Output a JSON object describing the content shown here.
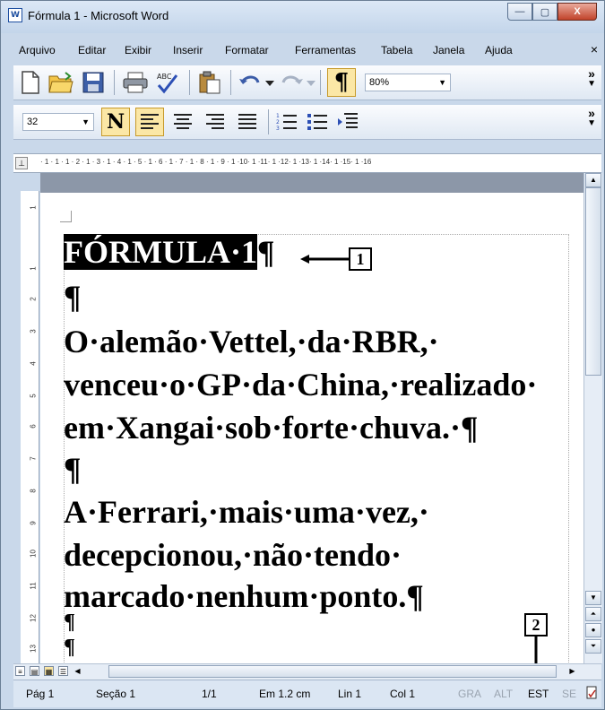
{
  "window": {
    "title": "Fórmula 1 - Microsoft Word",
    "app_icon": "W"
  },
  "title_buttons": {
    "minimize": "—",
    "maximize": "▢",
    "close": "X"
  },
  "menu": {
    "items": [
      "Arquivo",
      "Editar",
      "Exibir",
      "Inserir",
      "Formatar",
      "Ferramentas",
      "Tabela",
      "Janela",
      "Ajuda"
    ],
    "close_doc": "×"
  },
  "toolbar_standard": {
    "icons": [
      "new-document-icon",
      "open-folder-icon",
      "save-icon",
      "print-icon",
      "spelling-icon",
      "paste-icon",
      "undo-icon",
      "redo-icon",
      "pilcrow-icon"
    ],
    "zoom": "80%",
    "chevron": "»"
  },
  "toolbar_format": {
    "font_size": "32",
    "bold_label": "N",
    "icons": [
      "align-left-icon",
      "align-center-icon",
      "align-right-icon",
      "justify-icon",
      "numbered-list-icon",
      "bullet-list-icon",
      "increase-indent-icon"
    ],
    "chevron": "»"
  },
  "ruler": {
    "numbers": "· 1 · 1 · 1 · 2 · 1 · 3 · 1 · 4 · 1 · 5 · 1 · 6 · 1 · 7 · 1 · 8 · 1 · 9 · 1 ·10· 1 ·11· 1 ·12· 1 ·13· 1 ·14· 1 ·15· 1 ·16",
    "vertical_numbers": [
      "1",
      "1",
      "2",
      "3",
      "4",
      "5",
      "6",
      "7",
      "8",
      "9",
      "10",
      "11",
      "12",
      "13"
    ]
  },
  "document": {
    "lines": [
      {
        "text": "FÓRMULA·1",
        "selected": true,
        "suffix": "¶"
      },
      {
        "text": "¶"
      },
      {
        "text": "O·alemão·Vettel,·da·RBR,·"
      },
      {
        "text": "venceu·o·GP·da·China,·realizado·"
      },
      {
        "text": "em·Xangai·sob·forte·chuva.·¶"
      },
      {
        "text": "¶"
      },
      {
        "text": "A·Ferrari,·mais·uma·vez,·"
      },
      {
        "text": "decepcionou,·não·tendo·"
      },
      {
        "text": "marcado·nenhum·ponto.¶"
      },
      {
        "text": "¶"
      },
      {
        "text": "¶"
      }
    ]
  },
  "callouts": {
    "one": "1",
    "two": "2"
  },
  "status_bar": {
    "page": "Pág 1",
    "section": "Seção 1",
    "pages": "1/1",
    "position": "Em 1.2 cm",
    "line": "Lin 1",
    "column": "Col 1",
    "modes": [
      {
        "label": "GRA",
        "active": false
      },
      {
        "label": "ALT",
        "active": false
      },
      {
        "label": "EST",
        "active": true
      },
      {
        "label": "SE",
        "active": false
      }
    ]
  },
  "colors": {
    "selection": "#000000",
    "chrome": "#c9d8ea",
    "page_gap": "#8c97a8"
  }
}
